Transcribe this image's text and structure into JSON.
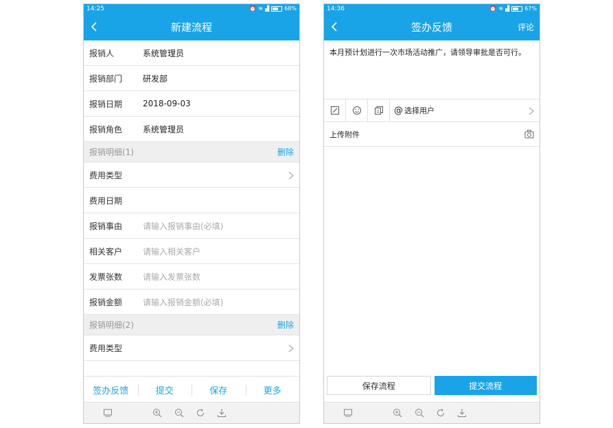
{
  "left": {
    "status": {
      "time": "14:25",
      "battery": "68%",
      "battery_fraction": 0.68
    },
    "title": "新建流程",
    "fields": [
      {
        "label": "报销人",
        "value": "系统管理员"
      },
      {
        "label": "报销部门",
        "value": "研发部"
      },
      {
        "label": "报销日期",
        "value": "2018-09-03"
      },
      {
        "label": "报销角色",
        "value": "系统管理员"
      }
    ],
    "section1": {
      "title": "报销明细(1)",
      "delete": "删除",
      "rows": [
        {
          "label": "费用类型"
        },
        {
          "label": "费用日期"
        },
        {
          "label": "报销事由",
          "placeholder": "请输入报销事由(必填)"
        },
        {
          "label": "相关客户",
          "placeholder": "请输入相关客户"
        },
        {
          "label": "发票张数",
          "placeholder": "请输入发票张数"
        },
        {
          "label": "报销金额",
          "placeholder": "请输入报销金额(必填)"
        }
      ]
    },
    "section2": {
      "title": "报销明细(2)",
      "delete": "删除",
      "rows": [
        {
          "label": "费用类型"
        }
      ]
    },
    "actions": [
      "签办反馈",
      "提交",
      "保存",
      "更多"
    ]
  },
  "right": {
    "status": {
      "time": "14:36",
      "battery": "67%",
      "battery_fraction": 0.67
    },
    "title": "签办反馈",
    "comment": "评论",
    "message": "本月预计划进行一次市场活动推广，请领导审批是否可行。",
    "select_user": "选择用户",
    "upload": "上传附件",
    "save_flow": "保存流程",
    "submit_flow": "提交流程"
  },
  "colors": {
    "accent": "#1aa4e8",
    "divider": "#e3e3e3",
    "placeholder": "#aaaaaa"
  }
}
